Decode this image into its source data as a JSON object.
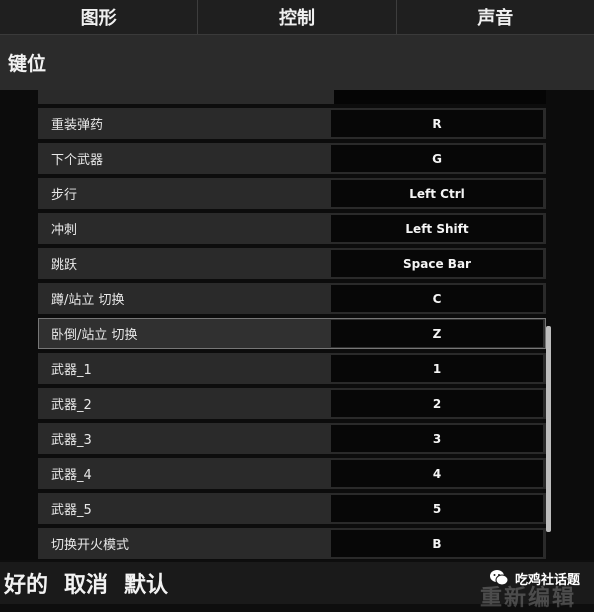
{
  "tabs": [
    {
      "label": "图形"
    },
    {
      "label": "控制"
    },
    {
      "label": "声音"
    }
  ],
  "section": {
    "title": "键位"
  },
  "bindings": [
    {
      "action": "重装弹药",
      "key": "R"
    },
    {
      "action": "下个武器",
      "key": "G"
    },
    {
      "action": "步行",
      "key": "Left Ctrl"
    },
    {
      "action": "冲刺",
      "key": "Left Shift"
    },
    {
      "action": "跳跃",
      "key": "Space Bar"
    },
    {
      "action": "蹲/站立 切换",
      "key": "C"
    },
    {
      "action": "卧倒/站立 切换",
      "key": "Z",
      "selected": true
    },
    {
      "action": "武器_1",
      "key": "1"
    },
    {
      "action": "武器_2",
      "key": "2"
    },
    {
      "action": "武器_3",
      "key": "3"
    },
    {
      "action": "武器_4",
      "key": "4"
    },
    {
      "action": "武器_5",
      "key": "5"
    },
    {
      "action": "切换开火模式",
      "key": "B"
    }
  ],
  "footer": {
    "ok_label": "好的",
    "cancel_label": "取消",
    "default_label": "默认"
  },
  "watermark": {
    "text": "吃鸡社话题",
    "overlay_text": "重新编辑",
    "icon": "wechat-icon"
  }
}
